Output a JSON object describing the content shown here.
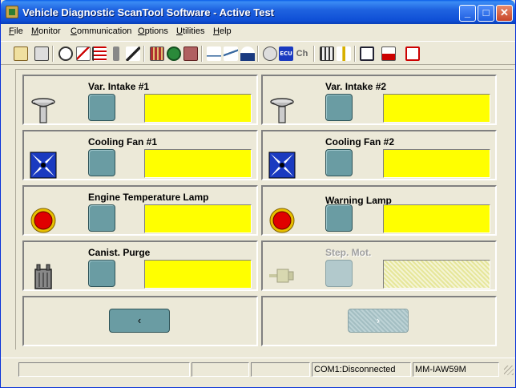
{
  "window": {
    "title": "Vehicle Diagnostic ScanTool Software - Active Test",
    "minimize_glyph": "_",
    "maximize_glyph": "□",
    "close_glyph": "✕"
  },
  "menu": [
    {
      "accel": "F",
      "rest": "ile"
    },
    {
      "accel": "M",
      "rest": "onitor"
    },
    {
      "accel": "C",
      "rest": "ommunication"
    },
    {
      "accel": "O",
      "rest": "ptions"
    },
    {
      "accel": "U",
      "rest": "tilities"
    },
    {
      "accel": "H",
      "rest": "elp"
    }
  ],
  "toolbar": {
    "icons": [
      "save-icon",
      "print-icon",
      "gauge-icon",
      "graph-icon",
      "bars-icon",
      "probe-icon",
      "wand-icon",
      "grid-icon",
      "gear-icon",
      "chip-icon",
      "line-chart-icon",
      "multi-line-icon",
      "dial-icon",
      "engine-icon",
      "ecu-icon",
      "channel-icon",
      "calculator-icon",
      "tree-icon",
      "book-icon",
      "download-icon",
      "exit-icon"
    ],
    "ecu_text": "ECU",
    "ch_text": "Ch"
  },
  "tests": [
    {
      "label": "Var. Intake #1",
      "icon": "valve-icon",
      "enabled": true,
      "value": ""
    },
    {
      "label": "Var. Intake #2",
      "icon": "valve-icon",
      "enabled": true,
      "value": ""
    },
    {
      "label": "Cooling Fan #1",
      "icon": "fan-icon",
      "enabled": true,
      "value": ""
    },
    {
      "label": "Cooling Fan #2",
      "icon": "fan-icon",
      "enabled": true,
      "value": ""
    },
    {
      "label": "Engine Temperature Lamp",
      "icon": "lamp-icon",
      "enabled": true,
      "value": ""
    },
    {
      "label": "Warning Lamp",
      "icon": "lamp-icon",
      "enabled": true,
      "value": ""
    },
    {
      "label": "Canist. Purge",
      "icon": "canister-icon",
      "enabled": true,
      "value": ""
    },
    {
      "label": "Step. Mot.",
      "icon": "stepper-motor-icon",
      "enabled": false,
      "value": ""
    }
  ],
  "nav": {
    "prev_label": "‹",
    "next_label": "›",
    "next_enabled": false
  },
  "status": {
    "pane1": "",
    "pane2": "",
    "pane3": "",
    "port": "COM1:Disconnected",
    "ecu": "MM-IAW59M"
  },
  "colors": {
    "value_box": "#ffff00",
    "button": "#6a9ca3",
    "lamp": "#e00000"
  }
}
